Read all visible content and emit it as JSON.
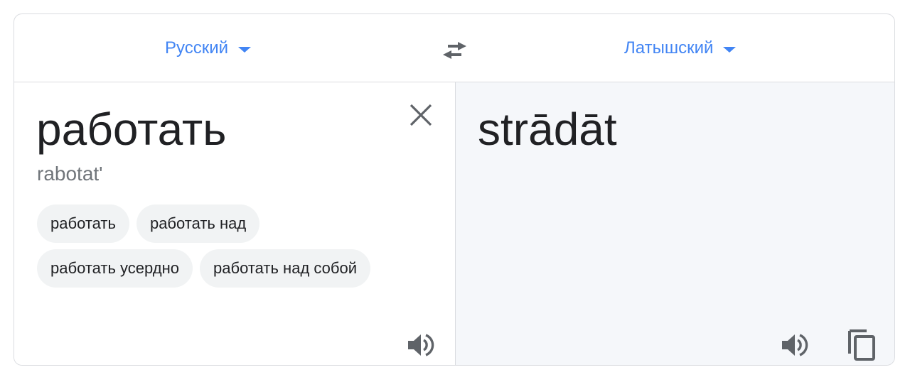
{
  "header": {
    "source_language": "Русский",
    "target_language": "Латышский"
  },
  "source": {
    "text": "работать",
    "transliteration": "rabotat'",
    "suggestions": [
      "работать",
      "работать над",
      "работать усердно",
      "работать над собой"
    ]
  },
  "target": {
    "text": "strādāt"
  },
  "icons": {
    "source_dropdown": "chevron-down-icon",
    "target_dropdown": "chevron-down-icon",
    "swap": "swap-icon",
    "clear": "close-icon",
    "source_speak": "speaker-icon",
    "target_speak": "speaker-icon",
    "copy": "copy-icon"
  },
  "colors": {
    "accent": "#4285f4",
    "text_primary": "#202124",
    "text_secondary": "#70757a",
    "chip_bg": "#f1f3f4",
    "target_pane_bg": "#f5f7fa",
    "icon_gray": "#5f6368"
  }
}
